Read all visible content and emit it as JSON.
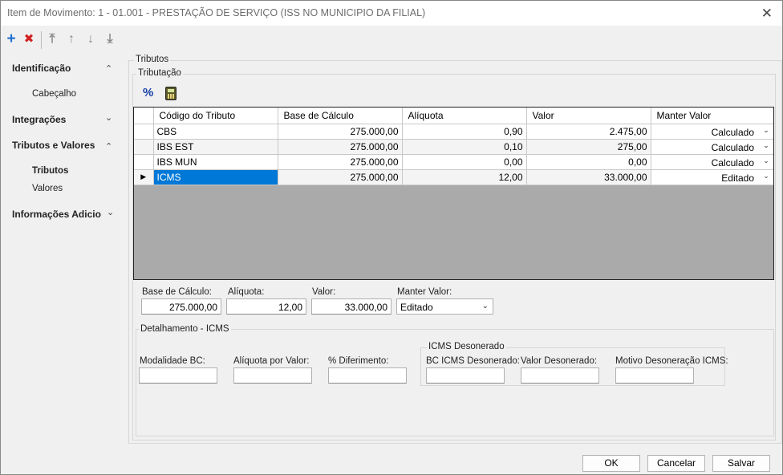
{
  "window": {
    "title": "Item de Movimento: 1 - 01.001 - PRESTAÇÃO DE SERVIÇO (ISS NO MUNICIPIO DA FILIAL)",
    "close_glyph": "✕"
  },
  "toolbar": {
    "add_glyph": "+",
    "delete_glyph": "✖",
    "first_glyph": "⤒",
    "up_glyph": "↑",
    "down_glyph": "↓",
    "last_glyph": "⤓"
  },
  "nav": {
    "sections": [
      {
        "label": "Identificação",
        "chevron": "⌃",
        "items": [
          "Cabeçalho"
        ]
      },
      {
        "label": "Integrações",
        "chevron": "⌄"
      },
      {
        "label": "Tributos e Valores",
        "chevron": "⌃",
        "items": [
          "Tributos",
          "Valores"
        ]
      },
      {
        "label": "Informações Adicio",
        "chevron": "⌄"
      }
    ]
  },
  "panel": {
    "outer_legend": "Tributos",
    "inner_legend": "Tributação",
    "percent_glyph": "%",
    "grid": {
      "columns": [
        "Código do Tributo",
        "Base de Cálculo",
        "Alíquota",
        "Valor",
        "Manter Valor"
      ],
      "rows": [
        {
          "codigo": "CBS",
          "base": "275.000,00",
          "aliquota": "0,90",
          "valor": "2.475,00",
          "manter": "Calculado"
        },
        {
          "codigo": "IBS EST",
          "base": "275.000,00",
          "aliquota": "0,10",
          "valor": "275,00",
          "manter": "Calculado"
        },
        {
          "codigo": "IBS MUN",
          "base": "275.000,00",
          "aliquota": "0,00",
          "valor": "0,00",
          "manter": "Calculado"
        },
        {
          "codigo": "ICMS",
          "base": "275.000,00",
          "aliquota": "12,00",
          "valor": "33.000,00",
          "manter": "Editado"
        }
      ],
      "current_row_indicator": "▶",
      "dropdown_glyph": "⌄"
    },
    "summary": {
      "base_label": "Base de Cálculo:",
      "base_value": "275.000,00",
      "aliquota_label": "Alíquota:",
      "aliquota_value": "12,00",
      "valor_label": "Valor:",
      "valor_value": "33.000,00",
      "manter_label": "Manter Valor:",
      "manter_value": "Editado",
      "manter_arrow": "⌄"
    },
    "detalhamento": {
      "legend": "Detalhamento - ICMS",
      "modalidade_label": "Modalidade BC:",
      "aliquota_valor_label": "Alíquota por Valor:",
      "diferimento_label": "% Diferimento:",
      "desonerado_legend": "ICMS Desonerado",
      "bc_desonerado_label": "BC ICMS Desonerado:",
      "valor_desonerado_label": "Valor Desonerado:",
      "motivo_label": "Motivo Desoneração ICMS:"
    }
  },
  "footer": {
    "ok": "OK",
    "cancel": "Cancelar",
    "save": "Salvar"
  }
}
